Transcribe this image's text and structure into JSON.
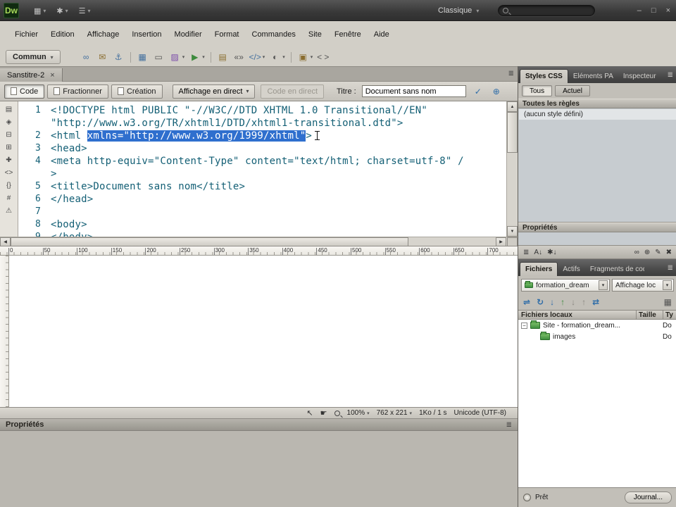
{
  "colors": {
    "selection": "#2f6fce",
    "code_text": "#135f75",
    "chrome": "#d2cfc7",
    "titlebar": "#3a3a3a",
    "site_folder_green": "#3f8f3f"
  },
  "glyphs": {
    "chevron_down": "▾",
    "panel_menu": "≣",
    "pointer": "↖",
    "hand": "☛",
    "up_arrow": "▲",
    "down_arrow": "▼",
    "left_arrow": "◀",
    "right_arrow": "▶",
    "expander_minus": "−",
    "close": "×",
    "check": "✓",
    "globe": "⊕"
  },
  "titlebar": {
    "app_initials": "Dw",
    "icons": [
      {
        "name": "workspace-layout-icon",
        "glyph": "▦"
      },
      {
        "name": "extend-icon",
        "glyph": "✱"
      },
      {
        "name": "site-menu-icon",
        "glyph": "☰"
      }
    ],
    "workspace": "Classique",
    "search_value": "",
    "window_buttons": [
      {
        "name": "minimize-button",
        "glyph": "–"
      },
      {
        "name": "maximize-button",
        "glyph": "□"
      },
      {
        "name": "close-button",
        "glyph": "×"
      }
    ]
  },
  "menubar": {
    "items": [
      "Fichier",
      "Edition",
      "Affichage",
      "Insertion",
      "Modifier",
      "Format",
      "Commandes",
      "Site",
      "Fenêtre",
      "Aide"
    ]
  },
  "insert_bar": {
    "category": "Commun",
    "icons": [
      {
        "name": "hyperlink-icon",
        "glyph": "∞",
        "color": "#44709e"
      },
      {
        "name": "email-link-icon",
        "glyph": "✉",
        "color": "#8a6d2f"
      },
      {
        "name": "named-anchor-icon",
        "glyph": "⚓",
        "color": "#44709e"
      },
      {
        "sep": true
      },
      {
        "name": "table-icon",
        "glyph": "▦",
        "color": "#44709e"
      },
      {
        "name": "insert-div-icon",
        "glyph": "▭",
        "color": "#555555"
      },
      {
        "name": "image-icon",
        "glyph": "▨",
        "color": "#7a4aa9",
        "arrow": true
      },
      {
        "name": "media-icon",
        "glyph": "▶",
        "color": "#3c8a3c",
        "arrow": true
      },
      {
        "sep": true
      },
      {
        "name": "date-icon",
        "glyph": "▤",
        "color": "#8a6d2f"
      },
      {
        "name": "comment-icon",
        "glyph": "«»",
        "color": "#555555"
      },
      {
        "name": "script-icon",
        "glyph": "</>",
        "color": "#44709e",
        "arrow": true
      },
      {
        "name": "head-icon",
        "glyph": "◐",
        "color": "#555555",
        "arrow": true
      },
      {
        "sep": true
      },
      {
        "name": "templates-icon",
        "glyph": "▣",
        "color": "#8a6d2f",
        "arrow": true
      },
      {
        "name": "tag-chooser-icon",
        "glyph": "< >",
        "color": "#555555"
      }
    ]
  },
  "doc_tab": {
    "label": "Sanstitre-2"
  },
  "doc_toolbar": {
    "code": "Code",
    "split": "Fractionner",
    "design": "Création",
    "live_view": "Affichage en direct",
    "live_code": "Code en direct",
    "title_label": "Titre :",
    "title_value": "Document sans nom"
  },
  "code": {
    "strip_icons": [
      {
        "name": "open-documents-icon",
        "glyph": "▤"
      },
      {
        "name": "code-navigator-icon",
        "glyph": "◈"
      },
      {
        "name": "collapse-full-tag-icon",
        "glyph": "⊟"
      },
      {
        "name": "collapse-selection-icon",
        "glyph": "⊞"
      },
      {
        "name": "expand-all-icon",
        "glyph": "✚"
      },
      {
        "name": "select-parent-tag-icon",
        "glyph": "<>"
      },
      {
        "name": "balance-braces-icon",
        "glyph": "{}"
      },
      {
        "name": "line-numbers-icon",
        "glyph": "#"
      },
      {
        "name": "highlight-invalid-icon",
        "glyph": "⚠"
      }
    ],
    "lines": [
      {
        "num": "1",
        "segments": [
          {
            "t": "<!DOCTYPE html PUBLIC \"-//W3C//DTD XHTML 1.0 Transitional//EN\""
          }
        ]
      },
      {
        "num": "",
        "segments": [
          {
            "t": "\"http://www.w3.org/TR/xhtml1/DTD/xhtml1-transitional.dtd\">"
          }
        ]
      },
      {
        "num": "2",
        "segments": [
          {
            "t": "<html "
          },
          {
            "t": "xmlns=\"http://www.w3.org/1999/xhtml\"",
            "sel": true
          },
          {
            "t": ">"
          }
        ],
        "cursor": true
      },
      {
        "num": "3",
        "segments": [
          {
            "t": "<head>"
          }
        ]
      },
      {
        "num": "4",
        "segments": [
          {
            "t": "<meta http-equiv=\"Content-Type\" content=\"text/html; charset=utf-8\" /"
          }
        ]
      },
      {
        "num": "",
        "segments": [
          {
            "t": ">"
          }
        ]
      },
      {
        "num": "5",
        "segments": [
          {
            "t": "<title>Document sans nom</title>"
          }
        ]
      },
      {
        "num": "6",
        "segments": [
          {
            "t": "</head>"
          }
        ]
      },
      {
        "num": "7",
        "segments": []
      },
      {
        "num": "8",
        "segments": [
          {
            "t": "<body>"
          }
        ]
      },
      {
        "num": "9",
        "segments": [
          {
            "t": "</body>"
          }
        ]
      }
    ]
  },
  "ruler": {
    "ticks": [
      "0",
      "50",
      "100",
      "150",
      "200",
      "250",
      "300",
      "350",
      "400",
      "450",
      "500",
      "550",
      "600",
      "650",
      "700"
    ]
  },
  "status_bar": {
    "zoom": "100%",
    "dimensions": "762 x 221",
    "weight": "1Ko / 1 s",
    "encoding": "Unicode (UTF-8)"
  },
  "properties_panel": {
    "title": "Propriétés"
  },
  "css_panel": {
    "tabs": [
      "Styles CSS",
      "Eléments PA",
      "Inspecteur"
    ],
    "all_button": "Tous",
    "current_button": "Actuel",
    "rules_header": "Toutes les règles",
    "no_style": "(aucun style défini)",
    "properties_header": "Propriétés",
    "toolbar_left": [
      {
        "name": "category-view-icon",
        "glyph": "≣"
      },
      {
        "name": "list-view-icon",
        "glyph": "A↓"
      },
      {
        "name": "set-properties-view-icon",
        "glyph": "✱↓"
      }
    ],
    "toolbar_right": [
      {
        "name": "attach-stylesheet-icon",
        "glyph": "∞"
      },
      {
        "name": "new-rule-icon",
        "glyph": "⊕"
      },
      {
        "name": "edit-rule-icon",
        "glyph": "✎"
      },
      {
        "name": "delete-rule-icon",
        "glyph": "✖"
      }
    ]
  },
  "files_panel": {
    "tabs": [
      "Fichiers",
      "Actifs",
      "Fragments de code"
    ],
    "site": "formation_dream",
    "view": "Affichage loc",
    "toolbar": [
      {
        "name": "connect-icon",
        "glyph": "⇌",
        "color": "#2f6da8"
      },
      {
        "name": "refresh-icon",
        "glyph": "↻",
        "color": "#2f6da8"
      },
      {
        "name": "get-files-icon",
        "glyph": "↓",
        "color": "#2f6da8"
      },
      {
        "name": "put-files-icon",
        "glyph": "↑",
        "color": "#3c8a3c"
      },
      {
        "name": "check-out-icon",
        "glyph": "↓",
        "color": "#8a8781"
      },
      {
        "name": "check-in-icon",
        "glyph": "↑",
        "color": "#8a8781"
      },
      {
        "name": "synchronize-icon",
        "glyph": "⇄",
        "color": "#2f6da8"
      },
      {
        "name": "expand-panel-icon",
        "glyph": "▦",
        "color": "#555555",
        "right": true
      }
    ],
    "columns": [
      "Fichiers locaux",
      "Taille",
      "Ty"
    ],
    "rows": [
      {
        "indent": 0,
        "expander": true,
        "label": "Site - formation_dream...",
        "size": "",
        "type": "Do"
      },
      {
        "indent": 1,
        "expander": false,
        "label": "images",
        "size": "",
        "type": "Do"
      }
    ],
    "status": "Prêt",
    "journal": "Journal..."
  }
}
